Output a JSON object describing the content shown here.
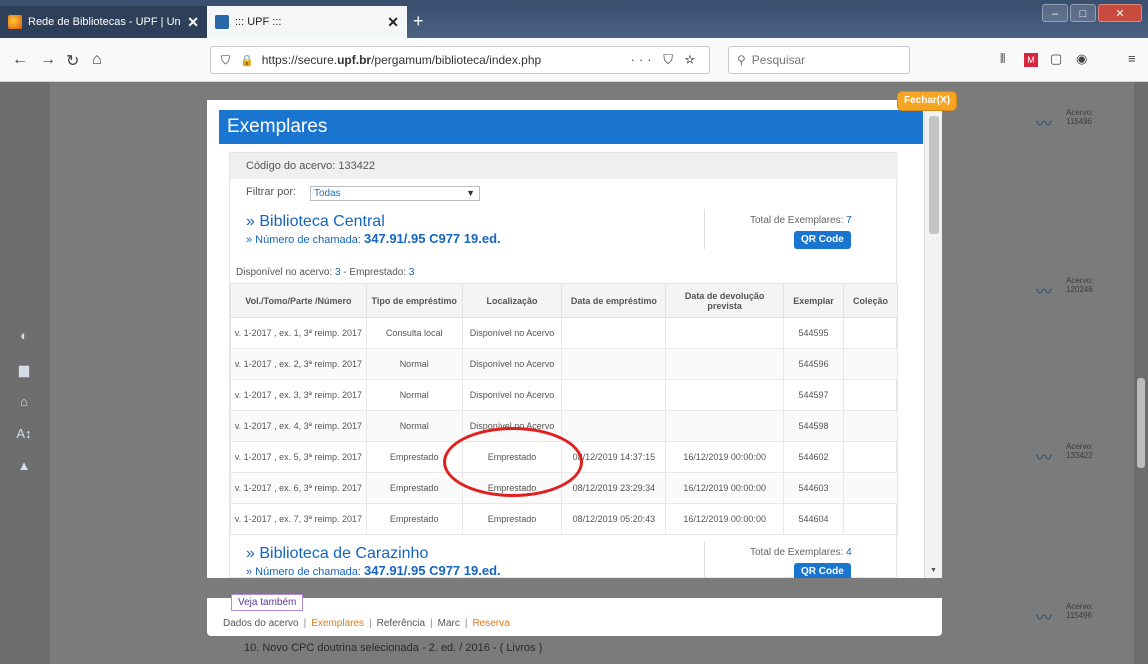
{
  "browser": {
    "tabs": [
      {
        "title": "Rede de Bibliotecas - UPF | Uni",
        "active": false
      },
      {
        "title": "::: UPF :::",
        "active": true
      }
    ],
    "new_tab_label": "+",
    "url": {
      "prefix": "https://secure.",
      "domain": "upf.br",
      "path": "/pergamum/biblioteca/index.php"
    },
    "url_menu": "···",
    "search_placeholder": "Pesquisar"
  },
  "background": {
    "rows": [
      {
        "label": "Acervo:",
        "code": "115496"
      },
      {
        "label": "Acervo:",
        "code": "120246"
      },
      {
        "label": "Acervo:",
        "code": "133422"
      },
      {
        "label": "Acervo:",
        "code": "115496"
      }
    ],
    "bottom_row": "10. Novo CPC doutrina selecionada - 2. ed. / 2016 - ( Livros )"
  },
  "modal": {
    "close_label": "Fechar(X)",
    "title": "Exemplares",
    "codigo": "Código do acervo: 133422",
    "filter_label": "Filtrar por:",
    "filter_value": "Todas",
    "libraries": [
      {
        "name": "» Biblioteca Central",
        "call_prefix": "» Número de chamada:",
        "call_number": "347.91/.95 C977 19.ed.",
        "total_label": "Total de Exemplares:",
        "total_value": "7",
        "qr_label": "QR Code",
        "disp_label": "Disponível no acervo:",
        "disp_value": "3",
        "emp_label": "- Emprestado:",
        "emp_value": "3"
      },
      {
        "name": "» Biblioteca de Carazinho",
        "call_prefix": "» Número de chamada:",
        "call_number": "347.91/.95 C977 19.ed.",
        "total_label": "Total de Exemplares:",
        "total_value": "4",
        "qr_label": "QR Code"
      }
    ],
    "table": {
      "headers": [
        "Vol./Tomo/Parte /Número",
        "Tipo de empréstimo",
        "Localização",
        "Data de empréstimo",
        "Data de devolução prevista",
        "Exemplar",
        "Coleção"
      ],
      "rows": [
        {
          "vol": "v. 1-2017 , ex. 1, 3ª reimp. 2017",
          "tipo": "Consulta local",
          "loc": "Disponível no Acervo",
          "emp": "",
          "dev": "",
          "exe": "544595",
          "col": ""
        },
        {
          "vol": "v. 1-2017 , ex. 2, 3ª reimp. 2017",
          "tipo": "Normal",
          "loc": "Disponível no Acervo",
          "emp": "",
          "dev": "",
          "exe": "544596",
          "col": ""
        },
        {
          "vol": "v. 1-2017 , ex. 3, 3ª reimp. 2017",
          "tipo": "Normal",
          "loc": "Disponível no Acervo",
          "emp": "",
          "dev": "",
          "exe": "544597",
          "col": ""
        },
        {
          "vol": "v. 1-2017 , ex. 4, 3ª reimp. 2017",
          "tipo": "Normal",
          "loc": "Disponível no Acervo",
          "emp": "",
          "dev": "",
          "exe": "544598",
          "col": ""
        },
        {
          "vol": "v. 1-2017 , ex. 5, 3ª reimp. 2017",
          "tipo": "Emprestado",
          "loc": "Emprestado",
          "emp": "08/12/2019 14:37:15",
          "dev": "16/12/2019 00:00:00",
          "exe": "544602",
          "col": ""
        },
        {
          "vol": "v. 1-2017 , ex. 6, 3ª reimp. 2017",
          "tipo": "Emprestado",
          "loc": "Emprestado",
          "emp": "08/12/2019 23:29:34",
          "dev": "16/12/2019 00:00:00",
          "exe": "544603",
          "col": ""
        },
        {
          "vol": "v. 1-2017 , ex. 7, 3ª reimp. 2017",
          "tipo": "Emprestado",
          "loc": "Emprestado",
          "emp": "08/12/2019 05:20:43",
          "dev": "16/12/2019 00:00:00",
          "exe": "544604",
          "col": ""
        }
      ]
    }
  },
  "footer": {
    "veja_label": "Veja também",
    "links": [
      "Dados do acervo",
      "Exemplares",
      "Referência",
      "Marc",
      "Reserva"
    ],
    "separator": "|"
  },
  "colors": {
    "accent": "#1a75d1",
    "close": "#f5a524",
    "highlight_ellipse": "#e0201e",
    "link_active": "#e17a1a"
  }
}
